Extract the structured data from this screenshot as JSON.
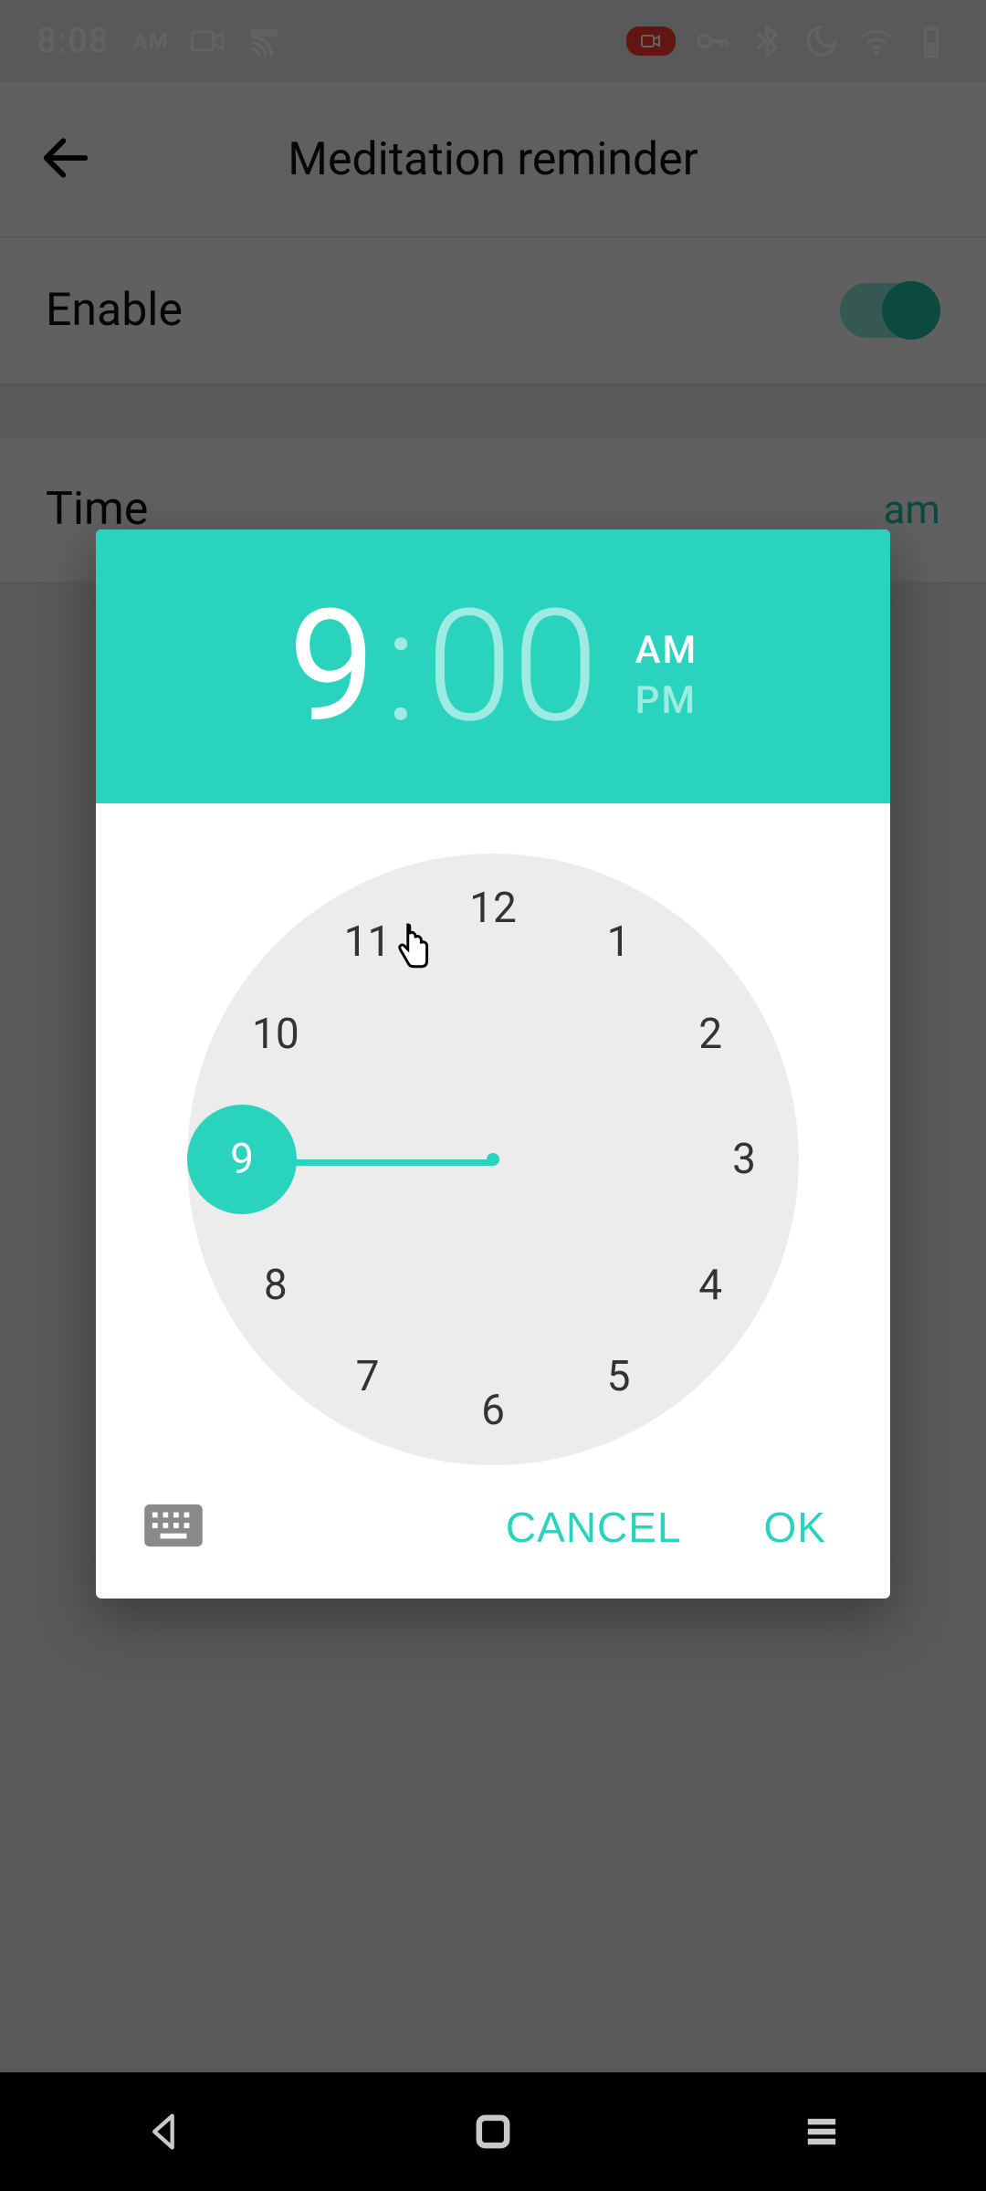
{
  "status_bar": {
    "time": "8:08",
    "ampm": "AM"
  },
  "header": {
    "title": "Meditation reminder"
  },
  "enable_row": {
    "label": "Enable",
    "on": true
  },
  "time_row": {
    "label": "Time",
    "value_suffix": "am"
  },
  "time_picker": {
    "hour": "9",
    "minute": "00",
    "am_label": "AM",
    "pm_label": "PM",
    "period": "AM",
    "selected_hour": 9,
    "hours": [
      "12",
      "1",
      "2",
      "3",
      "4",
      "5",
      "6",
      "7",
      "8",
      "9",
      "10",
      "11"
    ],
    "actions": {
      "cancel": "CANCEL",
      "ok": "OK"
    }
  }
}
